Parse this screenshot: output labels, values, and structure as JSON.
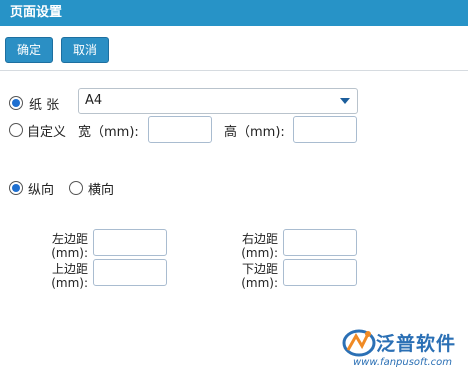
{
  "window": {
    "title": "页面设置"
  },
  "toolbar": {
    "confirm_label": "确定",
    "cancel_label": "取消"
  },
  "paper": {
    "label": "纸 张",
    "selected": "A4",
    "custom_label": "自定义",
    "width_label": "宽（mm):",
    "height_label": "高（mm):"
  },
  "orientation": {
    "portrait_label": "纵向",
    "landscape_label": "横向"
  },
  "margins": {
    "left_label_1": "左边距",
    "left_label_2": "(mm):",
    "right_label_1": "右边距",
    "right_label_2": "(mm):",
    "top_label_1": "上边距",
    "top_label_2": "(mm):",
    "bottom_label_1": "下边距",
    "bottom_label_2": "(mm):"
  },
  "branding": {
    "name": "泛普软件",
    "url": "www.fanpusoft.com"
  },
  "colors": {
    "titlebar": "#2793c7",
    "button": "#2b8fc4",
    "radio_selected": "#1e6fd0",
    "logo": "#2b70b5",
    "logo_accent": "#f08a24"
  }
}
